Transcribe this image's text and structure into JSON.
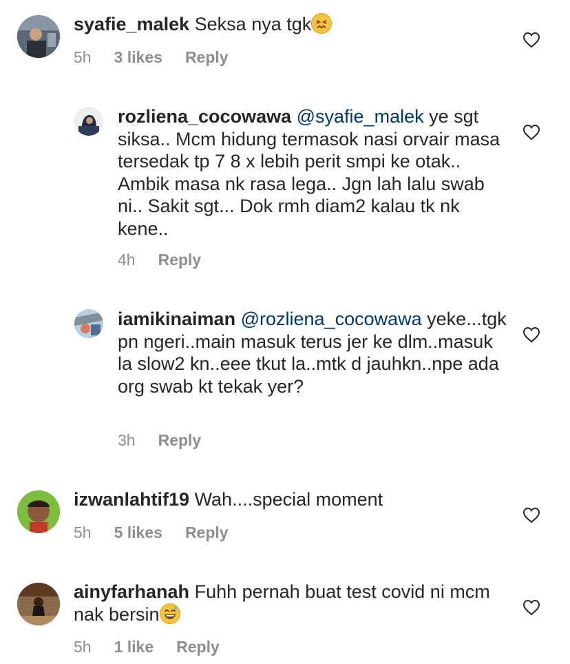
{
  "comments": [
    {
      "username": "syafie_malek",
      "text": "Seksa nya tgk",
      "time": "5h",
      "likes": "3 likes",
      "reply": "Reply",
      "emoji": "confounded-face"
    },
    {
      "username": "rozliena_cocowawa",
      "mention": "@syafie_malek",
      "text": "ye sgt siksa.. Mcm hidung termasok nasi orvair masa tersedak tp 7 8 x lebih perit smpi ke otak.. Ambik masa nk rasa lega.. Jgn lah lalu swab ni.. Sakit sgt... Dok rmh diam2 kalau tk nk kene..",
      "time": "4h",
      "reply": "Reply"
    },
    {
      "username": "iamikinaiman",
      "mention": "@rozliena_cocowawa",
      "text": "yeke...tgk pn ngeri..main masuk terus jer ke dlm..masuk la slow2 kn..eee tkut la..mtk d jauhkn..npe ada org swab kt tekak yer?",
      "time": "3h",
      "reply": "Reply"
    },
    {
      "username": "izwanlahtif19",
      "text": "Wah....special moment",
      "time": "5h",
      "likes": "5 likes",
      "reply": "Reply"
    },
    {
      "username": "ainyfarhanah",
      "text": "Fuhh pernah buat test covid ni mcm nak bersin",
      "time": "5h",
      "likes": "1 like",
      "reply": "Reply",
      "emoji": "grinning-sweat-face"
    }
  ]
}
